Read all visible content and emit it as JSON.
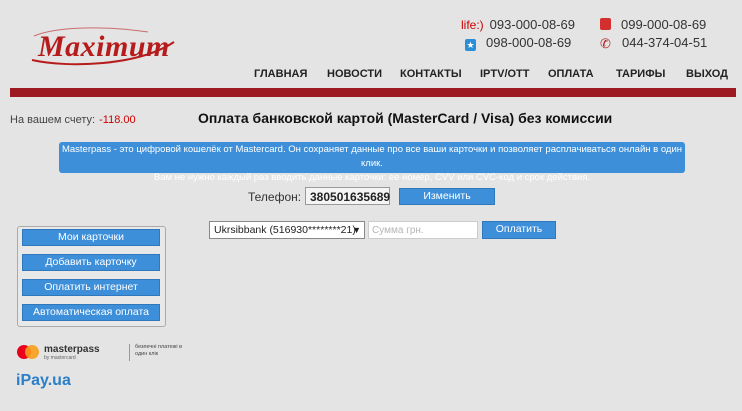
{
  "logo": {
    "text": "Maximum"
  },
  "contacts": {
    "life_label": "life:)",
    "life_phone": "093-000-08-69",
    "vodafone_phone": "099-000-08-69",
    "kyivstar_phone": "098-000-08-69",
    "landline_phone": "044-374-04-51"
  },
  "nav": {
    "items": [
      "ГЛАВНАЯ",
      "НОВОСТИ",
      "КОНТАКТЫ",
      "IPTV/OTT",
      "ОПЛАТА",
      "ТАРИФЫ",
      "ВЫХОД"
    ]
  },
  "account": {
    "label": "На вашем счету:",
    "amount": "-118.00"
  },
  "page": {
    "title": "Оплата банковской картой (MasterCard / Visa) без комиссии"
  },
  "info": {
    "line1": "Masterpass - это цифровой кошелёк от Mastercard. Он сохраняет данные про все ваши карточки и позволяет расплачиваться онлайн в один клик.",
    "line2": "Вам не нужно каждый раз вводить данные карточки: ее номер, CVV или CVC-код и срок действия."
  },
  "phone": {
    "label": "Телефон:",
    "value": "380501635689",
    "change_button": "Изменить"
  },
  "payment": {
    "card_selected": "Ukrsibbank (516930********21)",
    "amount_placeholder": "Сумма грн.",
    "pay_button": "Оплатить"
  },
  "side_menu": {
    "items": [
      "Мои карточки",
      "Добавить карточку",
      "Оплатить интернет",
      "Автоматическая оплата"
    ]
  },
  "footer": {
    "masterpass_name": "masterpass",
    "masterpass_sub": "by mastercard",
    "masterpass_tagline": "безпечні платежі в один клік",
    "ipay": "iPay",
    "ipay_suffix": ".ua"
  },
  "colors": {
    "brand_red": "#9e1a22",
    "button_blue": "#3d8fd9",
    "amount_red": "#cc0000"
  }
}
